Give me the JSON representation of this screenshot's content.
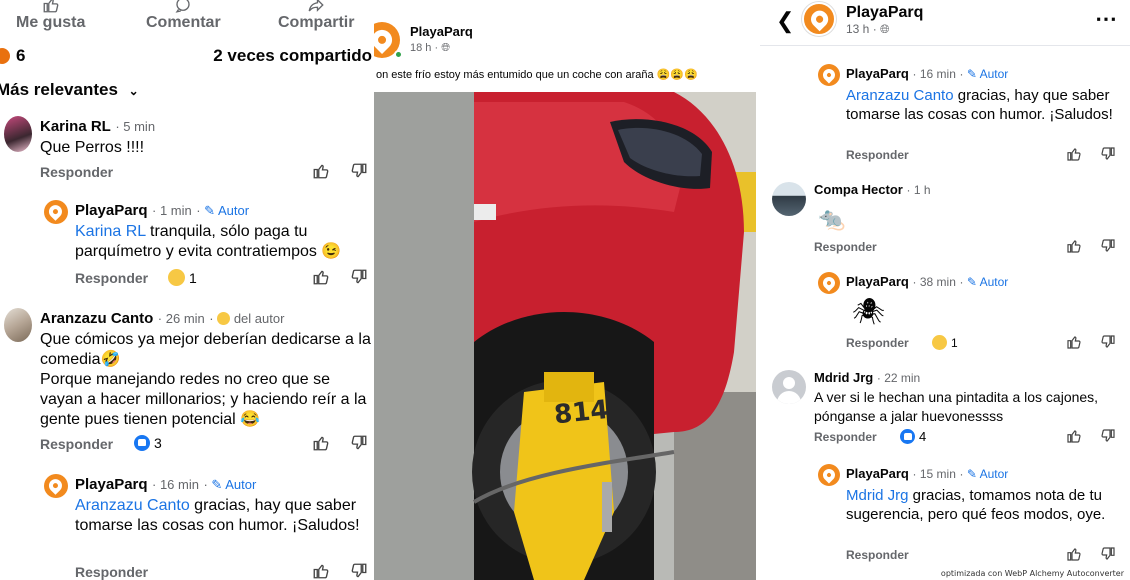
{
  "left": {
    "actions": {
      "like": "Me gusta",
      "comment": "Comentar",
      "share": "Compartir"
    },
    "reaction_count": "6",
    "share_count": "2 veces compartido",
    "sort_label": "Más relevantes",
    "comments": [
      {
        "name": "Karina RL",
        "time": "5 min",
        "text": "Que Perros !!!!",
        "reply": "Responder"
      },
      {
        "name": "PlayaParq",
        "time": "1 min",
        "author": "Autor",
        "mention": "Karina RL",
        "text": " tranquila, sólo paga tu parquímetro y evita contratiempos 😉",
        "reply": "Responder",
        "reactions": "1"
      },
      {
        "name": "Aranzazu Canto",
        "time": "26 min",
        "badge": "del autor",
        "text1": "Que cómicos ya mejor deberían dedicarse a la comedia🤣",
        "text2": "Porque manejando redes no creo que se vayan a hacer millonarios; y haciendo reír a la gente pues tienen potencial 😂",
        "reply": "Responder",
        "reactions": "3"
      },
      {
        "name": "PlayaParq",
        "time": "16 min",
        "author": "Autor",
        "mention": "Aranzazu Canto",
        "text": " gracias, hay que saber tomarse las cosas con humor. ¡Saludos!",
        "reply": "Responder"
      }
    ]
  },
  "middle": {
    "page_name": "PlayaParq",
    "time": "18 h",
    "caption": "on este frío estoy más entumido que un coche con araña 😩😩😩",
    "plate_text": "814"
  },
  "right": {
    "page_name": "PlayaParq",
    "time": "13 h",
    "comments": [
      {
        "name": "PlayaParq",
        "time": "16 min",
        "author": "Autor",
        "mention": "Aranzazu Canto",
        "text": " gracias, hay que saber tomarse las cosas con humor. ¡Saludos!",
        "reply": "Responder"
      },
      {
        "name": "Compa Hector",
        "time": "1 h",
        "text": "🐀",
        "reply": "Responder"
      },
      {
        "name": "PlayaParq",
        "time": "38 min",
        "author": "Autor",
        "text": "🕷",
        "reply": "Responder",
        "reactions": "1"
      },
      {
        "name": "Mdrid Jrg",
        "time": "22 min",
        "text": "A ver si le hechan una pintadita a los cajones, pónganse a jalar huevonessss",
        "reply": "Responder",
        "reactions": "4"
      },
      {
        "name": "PlayaParq",
        "time": "15 min",
        "author": "Autor",
        "mention": "Mdrid Jrg",
        "text": " gracias, tomamos nota de tu sugerencia, pero qué feos modos, oye.",
        "reply": "Responder"
      }
    ]
  },
  "watermark": "optimizada con WebP Alchemy Autoconverter",
  "colors": {
    "brand": "#f28a1e",
    "link": "#1b74e4",
    "meta": "#65676b",
    "car": "#c8202f",
    "clamp": "#f0c419"
  }
}
